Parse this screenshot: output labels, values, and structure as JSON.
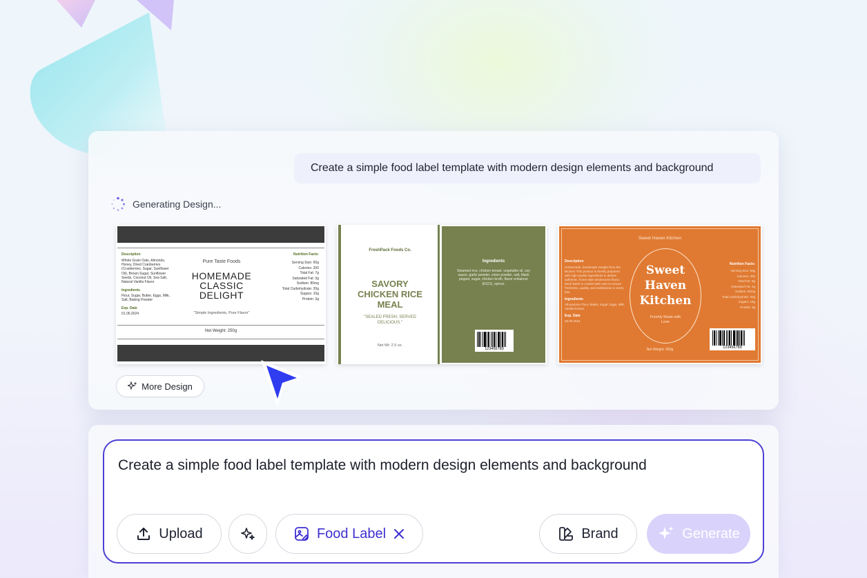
{
  "conversation": {
    "prompt": "Create a simple food label template with modern design elements and background",
    "status": "Generating Design..."
  },
  "designs": [
    {
      "type": "food-label",
      "top_left": "Description",
      "description": "Whole Grain Oats, Almonds, Honey, Dried Cranberries (Cranberries, Sugar, Sunflower Oil), Brown Sugar, Sunflower Seeds, Coconut Oil, Sea Salt, Natural Vanilla Flavor",
      "ingredients_title": "Ingredients",
      "ingredients": "Flour, Sugar, Butter, Eggs, Milk, Salt, Baking Powder",
      "exp_title": "Exp. Date",
      "exp_date": "01.06.2024",
      "brand": "Pure Taste Foods",
      "title_line1": "HOMEMADE",
      "title_line2": "CLASSIC",
      "title_line3": "DELIGHT",
      "tagline": "\"Simple Ingredients, Pure Flavor\"",
      "nutrition_title": "Nutrition Facts:",
      "nutrition": [
        "Serving Size: 60g",
        "Calories: 200",
        "Total Fat: 7g",
        "Saturated Fat: 3g",
        "Sodium: 80mg",
        "Total Carbohydrate: 20g",
        "Sugars: 10g",
        "Protein: 3g"
      ],
      "net_weight": "Net Weight: 250g"
    },
    {
      "type": "food-label",
      "brand": "FreshPack Foods Co.",
      "title_line1": "SAVORY",
      "title_line2": "CHICKEN RICE",
      "title_line3": "MEAL",
      "tagline": "\"SEALED FRESH, SERVED DELICIOUS.\"",
      "net_weight": "Net Wt: 2.5 oz.",
      "ingredients_title": "Ingredients",
      "ingredients": "Steamed rice, chicken breast, vegetable oil, soy sauce, garlic powder, onion powder, salt, black pepper, sugar, chicken broth, flavor enhancer (E621), spices.",
      "barcode_number": "123456789",
      "panel_color": "#76814f"
    },
    {
      "type": "food-label",
      "header": "Sweet Haven Kitchen",
      "title_line1": "Sweet",
      "title_line2": "Haven",
      "title_line3": "Kitchen",
      "subtitle": "Freshly Made with Love",
      "description_title": "Description",
      "description": "Homemade, handmade straight from the kitchen! This product is freshly prepared with high-quality ingredients to deliver authentic, home-style wholesome flavor. Each batch is cooked with care to ensure freshness, quality, and satisfaction in every bite.",
      "ingredients_title": "Ingredients",
      "ingredients": "All-purpose Flour, Butter, Sugar, Eggs, Milk, Vanilla Extract",
      "exp_title": "Exp. Date",
      "exp_date": "25.09.2024",
      "nutrition_title": "Nutrition Facts:",
      "nutrition": [
        "Serving Size: 60g",
        "Calories: 200",
        "Total Fat: 8g",
        "Saturated Fat: 4g",
        "Sodium: 90mg",
        "Total Carbohydrate: 30g",
        "Sugars: 18g",
        "Protein: 3g"
      ],
      "net_weight": "Net Weight: 350g",
      "barcode_number": "123456789",
      "bg_color": "#e07a32"
    }
  ],
  "more_design_label": "More Design",
  "composer": {
    "text": "Create a simple food label template with modern design elements and background",
    "upload_label": "Upload",
    "tag_label": "Food Label",
    "brand_label": "Brand",
    "generate_label": "Generate"
  },
  "colors": {
    "accent": "#4b3ed6",
    "cursor": "#2f3cf0",
    "generate_disabled": "#d9d3fb"
  }
}
